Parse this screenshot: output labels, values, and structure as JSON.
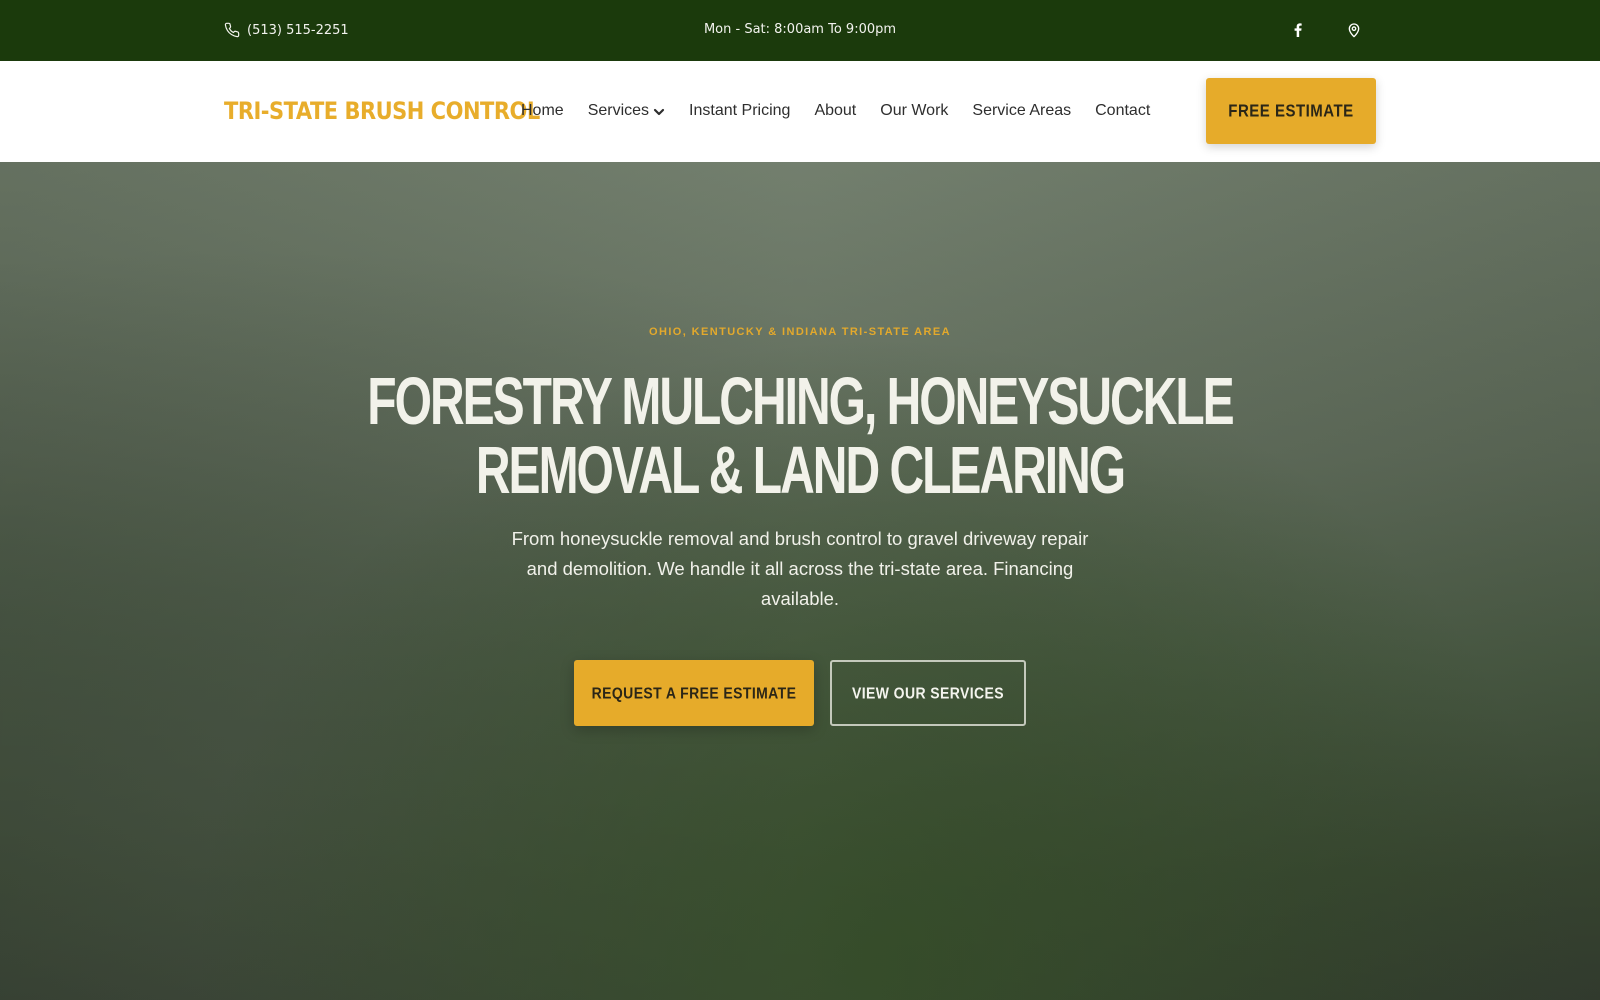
{
  "topbar": {
    "phone": "(513) 515-2251",
    "hours": "Mon - Sat: 8:00am To 9:00pm",
    "icons": [
      "phone-icon",
      "facebook-icon",
      "map-pin-icon"
    ]
  },
  "header": {
    "logo": "TRI-STATE BRUSH CONTROL",
    "nav": [
      {
        "label": "Home"
      },
      {
        "label": "Services",
        "has_dropdown": true
      },
      {
        "label": "Instant Pricing"
      },
      {
        "label": "About"
      },
      {
        "label": "Our Work"
      },
      {
        "label": "Service Areas"
      },
      {
        "label": "Contact"
      }
    ],
    "cta": "FREE ESTIMATE"
  },
  "hero": {
    "eyebrow": "OHIO, KENTUCKY & INDIANA TRI-STATE AREA",
    "headline_line1": "FORESTRY MULCHING, HONEYSUCKLE",
    "headline_line2": "REMOVAL & LAND CLEARING",
    "subtext": "From honeysuckle removal and brush control to gravel driveway repair and demolition. We handle it all across the tri-state area. Financing available.",
    "primary_button": "REQUEST A FREE ESTIMATE",
    "secondary_button": "VIEW OUR SERVICES"
  },
  "colors": {
    "topbar_bg": "#1b3a0c",
    "accent": "#e6ab2a",
    "header_bg": "#ffffff",
    "headline": "#f2f2ea"
  }
}
